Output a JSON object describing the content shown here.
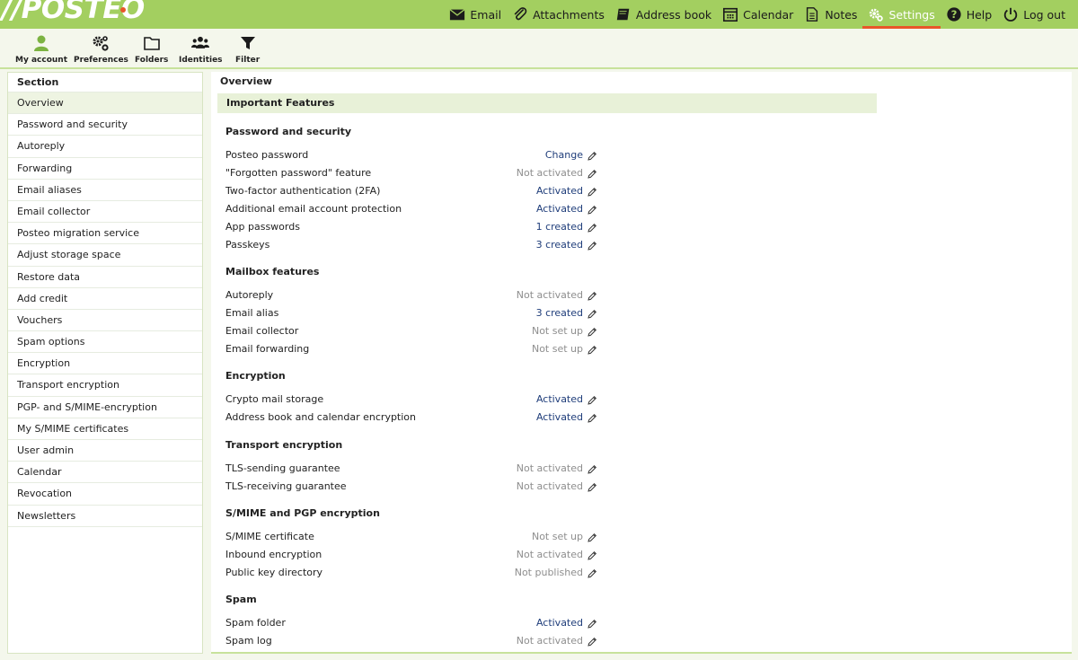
{
  "brand": {
    "logo_text": "//POSTEO"
  },
  "topnav": [
    {
      "label": "Email",
      "icon": "envelope-icon",
      "active": false
    },
    {
      "label": "Attachments",
      "icon": "paperclip-icon",
      "active": false
    },
    {
      "label": "Address book",
      "icon": "book-icon",
      "active": false
    },
    {
      "label": "Calendar",
      "icon": "calendar-icon",
      "active": false
    },
    {
      "label": "Notes",
      "icon": "note-icon",
      "active": false
    },
    {
      "label": "Settings",
      "icon": "gear-icon",
      "active": true
    },
    {
      "label": "Help",
      "icon": "help-icon",
      "active": false
    },
    {
      "label": "Log out",
      "icon": "power-icon",
      "active": false
    }
  ],
  "toolbar": [
    {
      "label": "My account",
      "icon": "user-icon"
    },
    {
      "label": "Preferences",
      "icon": "gears-icon"
    },
    {
      "label": "Folders",
      "icon": "folder-icon"
    },
    {
      "label": "Identities",
      "icon": "people-icon"
    },
    {
      "label": "Filter",
      "icon": "filter-icon"
    }
  ],
  "sidebar": {
    "heading": "Section",
    "items": [
      "Overview",
      "Password and security",
      "Autoreply",
      "Forwarding",
      "Email aliases",
      "Email collector",
      "Posteo migration service",
      "Adjust storage space",
      "Restore data",
      "Add credit",
      "Vouchers",
      "Spam options",
      "Encryption",
      "Transport encryption",
      "PGP- and S/MIME-encryption",
      "My S/MIME certificates",
      "User admin",
      "Calendar",
      "Revocation",
      "Newsletters"
    ],
    "selected": 0
  },
  "main": {
    "title": "Overview",
    "features_heading": "Important Features",
    "groups": [
      {
        "title": "Password and security",
        "rows": [
          {
            "label": "Posteo password",
            "value": "Change",
            "on": true
          },
          {
            "label": "\"Forgotten password\" feature",
            "value": "Not activated",
            "on": false
          },
          {
            "label": "Two-factor authentication (2FA)",
            "value": "Activated",
            "on": true
          },
          {
            "label": "Additional email account protection",
            "value": "Activated",
            "on": true
          },
          {
            "label": "App passwords",
            "value": "1 created",
            "on": true
          },
          {
            "label": "Passkeys",
            "value": "3 created",
            "on": true
          }
        ]
      },
      {
        "title": "Mailbox features",
        "rows": [
          {
            "label": "Autoreply",
            "value": "Not activated",
            "on": false
          },
          {
            "label": "Email alias",
            "value": "3 created",
            "on": true
          },
          {
            "label": "Email collector",
            "value": "Not set up",
            "on": false
          },
          {
            "label": "Email forwarding",
            "value": "Not set up",
            "on": false
          }
        ]
      },
      {
        "title": "Encryption",
        "rows": [
          {
            "label": "Crypto mail storage",
            "value": "Activated",
            "on": true
          },
          {
            "label": "Address book and calendar encryption",
            "value": "Activated",
            "on": true
          }
        ]
      },
      {
        "title": "Transport encryption",
        "rows": [
          {
            "label": "TLS-sending guarantee",
            "value": "Not activated",
            "on": false
          },
          {
            "label": "TLS-receiving guarantee",
            "value": "Not activated",
            "on": false
          }
        ]
      },
      {
        "title": "S/MIME and PGP encryption",
        "rows": [
          {
            "label": "S/MIME certificate",
            "value": "Not set up",
            "on": false
          },
          {
            "label": "Inbound encryption",
            "value": "Not activated",
            "on": false
          },
          {
            "label": "Public key directory",
            "value": "Not published",
            "on": false
          }
        ]
      },
      {
        "title": "Spam",
        "rows": [
          {
            "label": "Spam folder",
            "value": "Activated",
            "on": true
          },
          {
            "label": "Spam log",
            "value": "Not activated",
            "on": false
          }
        ]
      }
    ]
  },
  "colors": {
    "topbar": "#a3cf60",
    "accent": "#e8562a",
    "link": "#1f3d7a",
    "muted": "#8e8e8e"
  }
}
